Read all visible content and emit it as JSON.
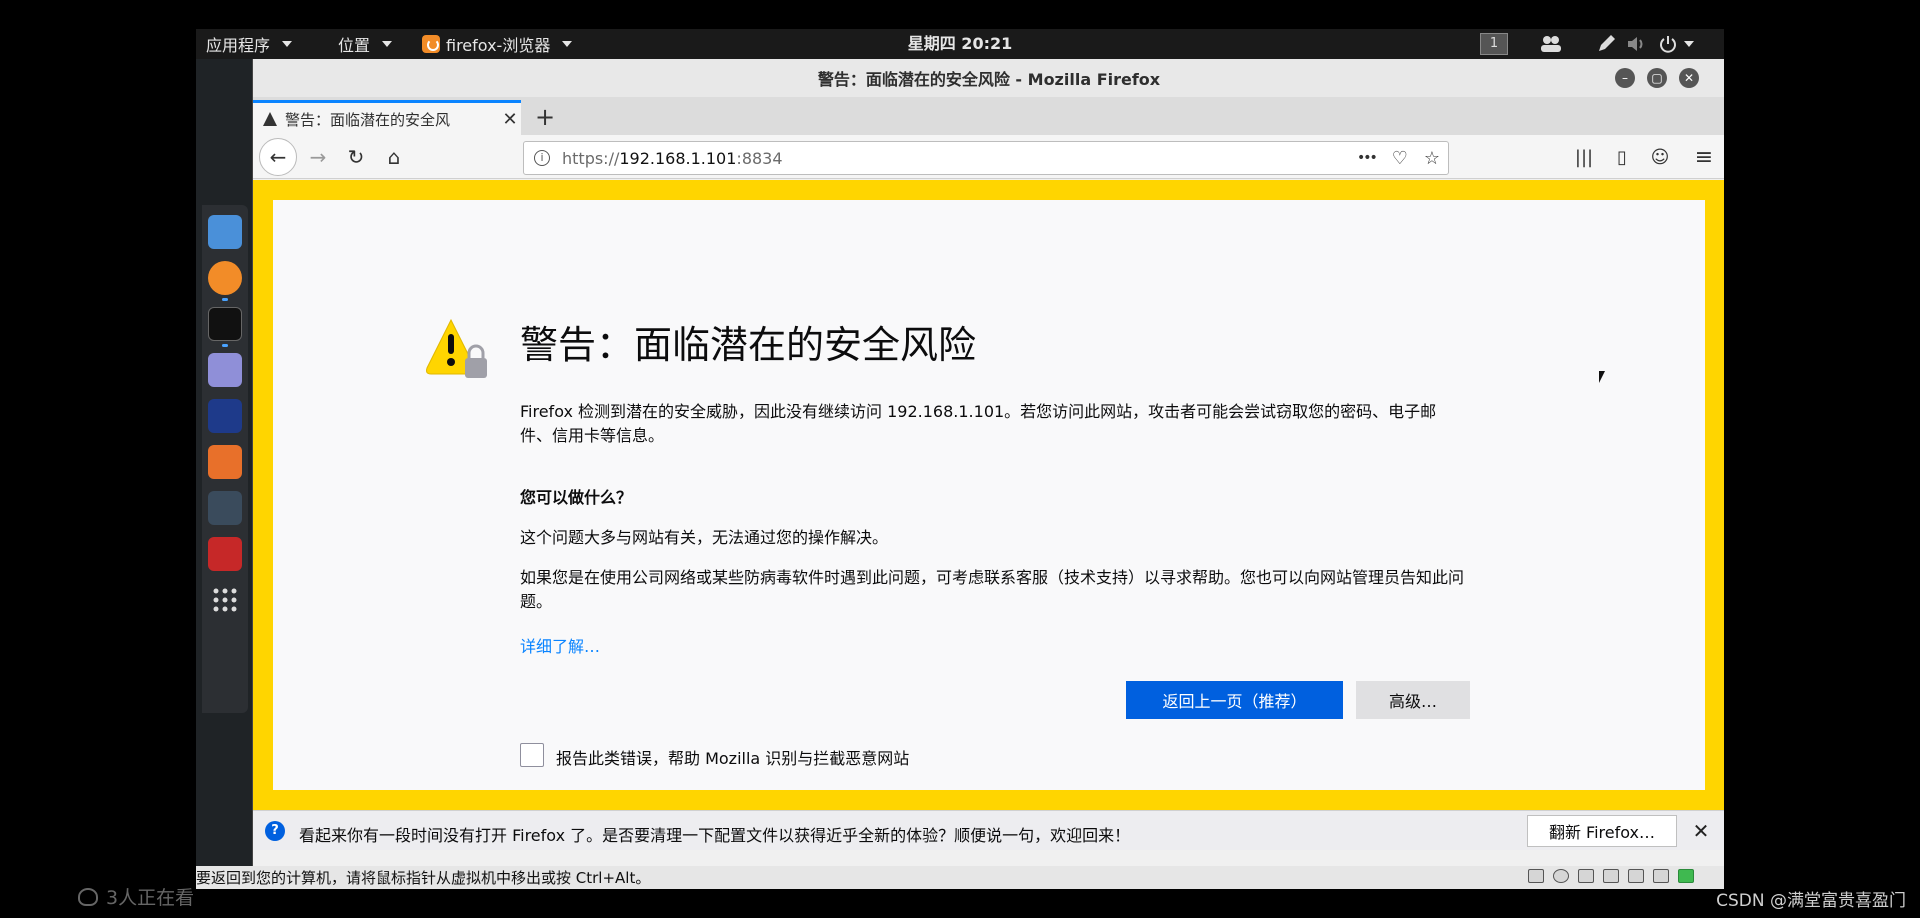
{
  "topbar": {
    "apps_menu": "应用程序",
    "places_menu": "位置",
    "browser_menu": "firefox-浏览器",
    "clock": "星期四 20:21",
    "workspace": "1"
  },
  "window": {
    "title": "警告：面临潜在的安全风险 - Mozilla Firefox"
  },
  "tab": {
    "label": "警告：面临潜在的安全风",
    "close": "✕",
    "new_tab": "+"
  },
  "navbar": {
    "back": "←",
    "forward": "→",
    "reload": "↻",
    "home": "⌂",
    "url_scheme": "https://",
    "url_host": "192.168.1.101",
    "url_port": ":8834",
    "page_actions": "•••",
    "pocket": "♡",
    "bookmark": "☆",
    "library": "|||",
    "sidebar": "▯",
    "account": "☺",
    "menu": "≡"
  },
  "page": {
    "title": "警告：面临潜在的安全风险",
    "description": "Firefox 检测到潜在的安全威胁，因此没有继续访问 192.168.1.101。若您访问此网站，攻击者可能会尝试窃取您的密码、电子邮件、信用卡等信息。",
    "what_heading": "您可以做什么？",
    "para1": "这个问题大多与网站有关，无法通过您的操作解决。",
    "para2": "如果您是在使用公司网络或某些防病毒软件时遇到此问题，可考虑联系客服（技术支持）以寻求帮助。您也可以向网站管理员告知此问题。",
    "learn_more": "详细了解…",
    "go_back_button": "返回上一页（推荐）",
    "advanced_button": "高级…",
    "report_label": "报告此类错误，帮助 Mozilla 识别与拦截恶意网站"
  },
  "notification": {
    "text": "看起来你有一段时间没有打开 Firefox 了。是否要清理一下配置文件以获得近乎全新的体验？顺便说一句，欢迎回来！",
    "button": "翻新 Firefox…",
    "close": "✕"
  },
  "vm_status": {
    "hint": "要返回到您的计算机，请将鼠标指针从虚拟机中移出或按 Ctrl+Alt。"
  },
  "overlay": {
    "viewers": "3人正在看",
    "watermark": "CSDN @满堂富贵喜盈门"
  },
  "colors": {
    "warning_border": "#ffd500",
    "primary_button": "#0060df",
    "link": "#0a84ff",
    "tab_accent": "#0a84ff"
  }
}
